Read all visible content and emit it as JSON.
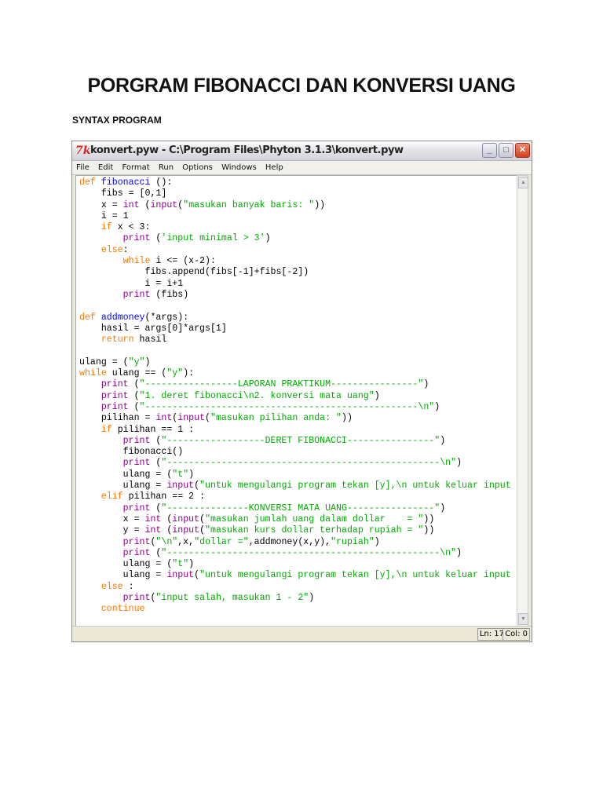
{
  "document": {
    "title": "PORGRAM FIBONACCI DAN KONVERSI UANG",
    "section": "SYNTAX PROGRAM"
  },
  "window": {
    "icon": "7k",
    "title": "konvert.pyw - C:\\Program Files\\Phyton 3.1.3\\konvert.pyw",
    "buttons": {
      "minimize": "_",
      "maximize": "□",
      "close": "✕"
    },
    "menu": [
      "File",
      "Edit",
      "Format",
      "Run",
      "Options",
      "Windows",
      "Help"
    ],
    "status": {
      "line": "Ln: 17",
      "col": "Col: 0"
    },
    "colors": {
      "keyword": "#ff7700",
      "builtin": "#900090",
      "string": "#00aa00",
      "defname": "#0000ff"
    }
  },
  "code": [
    [
      [
        "kw",
        "def "
      ],
      [
        "fn",
        "fibonacci"
      ],
      [
        "tx",
        " ():"
      ]
    ],
    [
      [
        "tx",
        "    fibs = [0,1]"
      ]
    ],
    [
      [
        "tx",
        "    x = "
      ],
      [
        "bi",
        "int"
      ],
      [
        "tx",
        " ("
      ],
      [
        "bi",
        "input"
      ],
      [
        "tx",
        "("
      ],
      [
        "st",
        "\"masukan banyak baris: \""
      ],
      [
        "tx",
        "))"
      ]
    ],
    [
      [
        "tx",
        "    i = 1"
      ]
    ],
    [
      [
        "kw",
        "    if"
      ],
      [
        "tx",
        " x < 3:"
      ]
    ],
    [
      [
        "bi",
        "        print"
      ],
      [
        "tx",
        " ("
      ],
      [
        "st",
        "'input minimal > 3'"
      ],
      [
        "tx",
        ")"
      ]
    ],
    [
      [
        "kw",
        "    else"
      ],
      [
        "tx",
        ":"
      ]
    ],
    [
      [
        "kw",
        "        while"
      ],
      [
        "tx",
        " i <= (x-2):"
      ]
    ],
    [
      [
        "tx",
        "            fibs.append(fibs[-1]+fibs[-2])"
      ]
    ],
    [
      [
        "tx",
        "            i = i+1"
      ]
    ],
    [
      [
        "bi",
        "        print"
      ],
      [
        "tx",
        " (fibs)"
      ]
    ],
    [
      [
        "tx",
        ""
      ]
    ],
    [
      [
        "kw",
        "def "
      ],
      [
        "fn",
        "addmoney"
      ],
      [
        "tx",
        "(*args):"
      ]
    ],
    [
      [
        "tx",
        "    hasil = args[0]*args[1]"
      ]
    ],
    [
      [
        "kw",
        "    return"
      ],
      [
        "tx",
        " hasil"
      ]
    ],
    [
      [
        "tx",
        ""
      ]
    ],
    [
      [
        "tx",
        "ulang = ("
      ],
      [
        "st",
        "\"y\""
      ],
      [
        "tx",
        ")"
      ]
    ],
    [
      [
        "kw",
        "while"
      ],
      [
        "tx",
        " ulang == ("
      ],
      [
        "st",
        "\"y\""
      ],
      [
        "tx",
        "):"
      ]
    ],
    [
      [
        "bi",
        "    print"
      ],
      [
        "tx",
        " ("
      ],
      [
        "st",
        "\"-----------------LAPORAN PRAKTIKUM----------------\""
      ],
      [
        "tx",
        ")"
      ]
    ],
    [
      [
        "bi",
        "    print"
      ],
      [
        "tx",
        " ("
      ],
      [
        "st",
        "\"1. deret fibonacci\\n2. konversi mata uang\""
      ],
      [
        "tx",
        ")"
      ]
    ],
    [
      [
        "bi",
        "    print"
      ],
      [
        "tx",
        " ("
      ],
      [
        "st",
        "\"--------------------------------------------------\\n\""
      ],
      [
        "tx",
        ")"
      ]
    ],
    [
      [
        "tx",
        "    pilihan = "
      ],
      [
        "bi",
        "int"
      ],
      [
        "tx",
        "("
      ],
      [
        "bi",
        "input"
      ],
      [
        "tx",
        "("
      ],
      [
        "st",
        "\"masukan pilihan anda: \""
      ],
      [
        "tx",
        "))"
      ]
    ],
    [
      [
        "kw",
        "    if"
      ],
      [
        "tx",
        " pilihan == 1 :"
      ]
    ],
    [
      [
        "bi",
        "        print"
      ],
      [
        "tx",
        " ("
      ],
      [
        "st",
        "\"------------------DERET FIBONACCI----------------\""
      ],
      [
        "tx",
        ")"
      ]
    ],
    [
      [
        "tx",
        "        fibonacci()"
      ]
    ],
    [
      [
        "bi",
        "        print"
      ],
      [
        "tx",
        " ("
      ],
      [
        "st",
        "\"--------------------------------------------------\\n\""
      ],
      [
        "tx",
        ")"
      ]
    ],
    [
      [
        "tx",
        "        ulang = ("
      ],
      [
        "st",
        "\"t\""
      ],
      [
        "tx",
        ")"
      ]
    ],
    [
      [
        "tx",
        "        ulang = "
      ],
      [
        "bi",
        "input"
      ],
      [
        "tx",
        "("
      ],
      [
        "st",
        "\"untuk mengulangi program tekan [y],\\n untuk keluar input"
      ]
    ],
    [
      [
        "kw",
        "    elif"
      ],
      [
        "tx",
        " pilihan == 2 :"
      ]
    ],
    [
      [
        "bi",
        "        print"
      ],
      [
        "tx",
        " ("
      ],
      [
        "st",
        "\"---------------KONVERSI MATA UANG----------------\""
      ],
      [
        "tx",
        ")"
      ]
    ],
    [
      [
        "tx",
        "        x = "
      ],
      [
        "bi",
        "int"
      ],
      [
        "tx",
        " ("
      ],
      [
        "bi",
        "input"
      ],
      [
        "tx",
        "("
      ],
      [
        "st",
        "\"masukan jumlah uang dalam dollar    = \""
      ],
      [
        "tx",
        "))"
      ]
    ],
    [
      [
        "tx",
        "        y = "
      ],
      [
        "bi",
        "int"
      ],
      [
        "tx",
        " ("
      ],
      [
        "bi",
        "input"
      ],
      [
        "tx",
        "("
      ],
      [
        "st",
        "\"masukan kurs dollar terhadap rupiah = \""
      ],
      [
        "tx",
        "))"
      ]
    ],
    [
      [
        "bi",
        "        print"
      ],
      [
        "tx",
        "("
      ],
      [
        "st",
        "\"\\n\""
      ],
      [
        "tx",
        ",x,"
      ],
      [
        "st",
        "\"dollar =\""
      ],
      [
        "tx",
        ",addmoney(x,y),"
      ],
      [
        "st",
        "\"rupiah\""
      ],
      [
        "tx",
        ")"
      ]
    ],
    [
      [
        "bi",
        "        print"
      ],
      [
        "tx",
        " ("
      ],
      [
        "st",
        "\"--------------------------------------------------\\n\""
      ],
      [
        "tx",
        ")"
      ]
    ],
    [
      [
        "tx",
        "        ulang = ("
      ],
      [
        "st",
        "\"t\""
      ],
      [
        "tx",
        ")"
      ]
    ],
    [
      [
        "tx",
        "        ulang = "
      ],
      [
        "bi",
        "input"
      ],
      [
        "tx",
        "("
      ],
      [
        "st",
        "\"untuk mengulangi program tekan [y],\\n untuk keluar input"
      ]
    ],
    [
      [
        "kw",
        "    else"
      ],
      [
        "tx",
        " :"
      ]
    ],
    [
      [
        "bi",
        "        print"
      ],
      [
        "tx",
        "("
      ],
      [
        "st",
        "\"input salah, masukan 1 - 2\""
      ],
      [
        "tx",
        ")"
      ]
    ],
    [
      [
        "kw",
        "    continue"
      ]
    ]
  ]
}
